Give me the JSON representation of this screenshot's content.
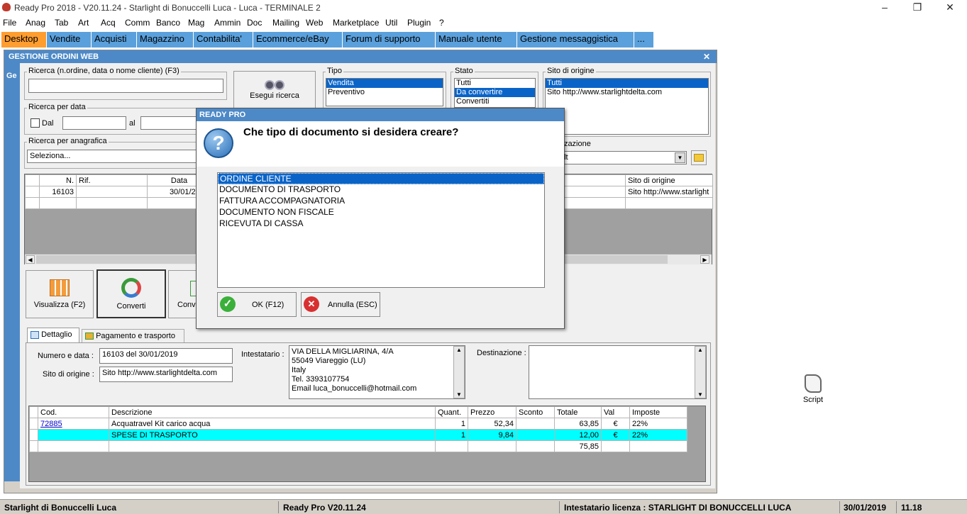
{
  "window": {
    "title": "Ready Pro 2018 - V20.11.24 - Starlight di Bonuccelli Luca - Luca - TERMINALE 2",
    "minimize": "–",
    "maximize": "❐",
    "close": "✕"
  },
  "menu": [
    "File",
    "Anag",
    "Tab",
    "Art",
    "Acq",
    "Comm",
    "Banco",
    "Mag",
    "Ammin",
    "Doc",
    "Mailing",
    "Web",
    "Marketplace",
    "Util",
    "Plugin",
    "?"
  ],
  "tabs": [
    "Desktop",
    "Vendite",
    "Acquisti",
    "Magazzino",
    "Contabilita'",
    "Ecommerce/eBay",
    "Forum di supporto",
    "Manuale utente",
    "Gestione messaggistica",
    "..."
  ],
  "main": {
    "title": "GESTIONE ORDINI WEB",
    "side_label": "Ge",
    "search_label": "Ricerca (n.ordine, data o nome cliente) (F3)",
    "search_value": "",
    "date_group_label": "Ricerca per data",
    "date_from_label": "Dal",
    "date_to_label": "al",
    "anag_group_label": "Ricerca per anagrafica",
    "anag_placeholder": "Seleziona...",
    "search_button_label": "Esegui ricerca",
    "tipo_label": "Tipo",
    "tipo_items": [
      "Vendita",
      "Preventivo"
    ],
    "stato_label": "Stato",
    "stato_items": [
      "Tutti",
      "Da convertire",
      "Convertiti"
    ],
    "sito_label": "Sito di origine",
    "sito_items": [
      "Tutti",
      "Sito http://www.starlightdelta.com"
    ],
    "visual_label": "izzazione",
    "visual_value": "ult",
    "grid_headers": [
      "N.",
      "Rif.",
      "Data",
      "Sito di origine"
    ],
    "grid_row": {
      "n": "16103",
      "rif": "",
      "data": "30/01/2019",
      "sito": "Sito http://www.starlight"
    },
    "buttons": {
      "visualizza": "Visualizza (F2)",
      "converti": "Converti",
      "conv2": "Conv"
    },
    "detail_tabs": [
      "Dettaglio",
      "Pagamento e trasporto"
    ],
    "numero_label": "Numero e data :",
    "numero_value": "16103 del 30/01/2019",
    "sito_origine_label": "Sito di origine :",
    "sito_origine_value": "Sito http://www.starlightdelta.com",
    "intestatario_label": "Intestatario :",
    "intestatario_lines": [
      "VIA DELLA MIGLIARINA, 4/A",
      "55049 Viareggio (LU)",
      "Italy",
      "Tel. 3393107754",
      "Email luca_bonuccelli@hotmail.com"
    ],
    "destinazione_label": "Destinazione :",
    "detail_headers": [
      "Cod.",
      "Descrizione",
      "Quant.",
      "Prezzo",
      "Sconto",
      "Totale",
      "Val",
      "Imposte"
    ],
    "detail_rows": [
      {
        "cod": "72885",
        "desc": "Acquatravel Kit carico acqua",
        "qta": "1",
        "prezzo": "52,34",
        "sconto": "",
        "totale": "63,85",
        "val": "€",
        "imposte": "22%"
      },
      {
        "cod": "",
        "desc": "SPESE DI TRASPORTO",
        "qta": "1",
        "prezzo": "9,84",
        "sconto": "",
        "totale": "12,00",
        "val": "€",
        "imposte": "22%"
      }
    ],
    "detail_total": "75,85"
  },
  "dialog": {
    "title": "READY PRO",
    "question": "Che tipo di documento si desidera creare?",
    "options": [
      "ORDINE CLIENTE",
      "DOCUMENTO DI TRASPORTO",
      "FATTURA ACCOMPAGNATORIA",
      "DOCUMENTO NON FISCALE",
      "RICEVUTA DI CASSA"
    ],
    "ok_label": "OK (F12)",
    "cancel_label": "Annulla (ESC)"
  },
  "desktop": {
    "script_label": "Script"
  },
  "status": {
    "company": "Starlight di Bonuccelli Luca",
    "version": "Ready Pro V20.11.24",
    "license": "Intestatario licenza : STARLIGHT DI BONUCCELLI LUCA",
    "date": "30/01/2019",
    "time": "11.18"
  },
  "colors": {
    "accent": "#4d89c7",
    "tab": "#5aa0dc",
    "tab_active": "#ff9d2e",
    "row_highlight": "#00ffff",
    "selection": "#0a64c8"
  }
}
